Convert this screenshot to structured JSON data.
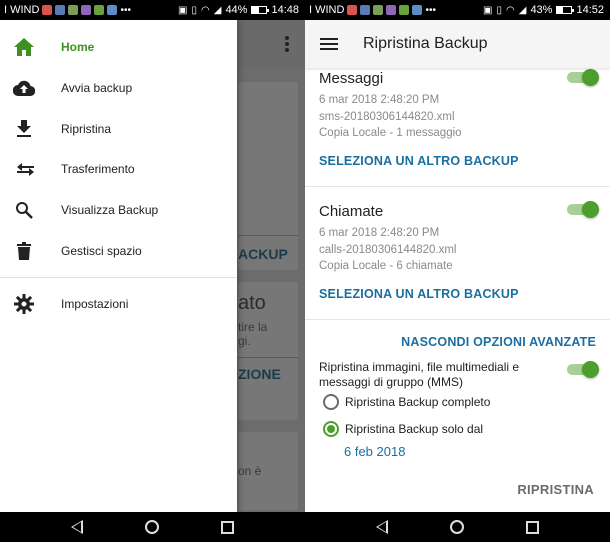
{
  "left": {
    "statusbar": {
      "carrier": "I WIND",
      "battery": "44%",
      "time": "14:48"
    },
    "background": {
      "partial_button_1": "ACKUP",
      "partial_title": "ato",
      "partial_text_1": "tire la",
      "partial_text_2": "gi.",
      "partial_button_2": "ZIONE",
      "partial_text_3": "on è"
    },
    "drawer": {
      "items": [
        {
          "label": "Home",
          "icon": "home-icon",
          "active": true
        },
        {
          "label": "Avvia backup",
          "icon": "cloud-upload-icon"
        },
        {
          "label": "Ripristina",
          "icon": "download-icon"
        },
        {
          "label": "Trasferimento",
          "icon": "transfer-icon"
        },
        {
          "label": "Visualizza Backup",
          "icon": "search-icon"
        },
        {
          "label": "Gestisci spazio",
          "icon": "trash-icon"
        }
      ],
      "settings": {
        "label": "Impostazioni",
        "icon": "gear-icon"
      }
    }
  },
  "right": {
    "statusbar": {
      "carrier": "I WIND",
      "battery": "43%",
      "time": "14:52"
    },
    "appbar": {
      "title": "Ripristina Backup"
    },
    "messaggi": {
      "title": "Messaggi",
      "date": "6 mar 2018 2:48:20 PM",
      "file": "sms-20180306144820.xml",
      "info": "Copia Locale - 1 messaggio",
      "link": "SELEZIONA UN ALTRO BACKUP"
    },
    "chiamate": {
      "title": "Chiamate",
      "date": "6 mar 2018 2:48:20 PM",
      "file": "calls-20180306144820.xml",
      "info": "Copia Locale - 6 chiamate",
      "link": "SELEZIONA UN ALTRO BACKUP"
    },
    "advanced": {
      "link": "NASCONDI OPZIONI AVANZATE",
      "mms_line1": "Ripristina immagini, file multimediali e",
      "mms_line2": "messaggi di gruppo (MMS)",
      "radio_full": "Ripristina Backup completo",
      "radio_since": "Ripristina Backup solo dal",
      "since_date": "6 feb 2018"
    },
    "footer": {
      "restore_button": "RIPRISTINA"
    }
  },
  "colors": {
    "accent_green": "#4e9e2e",
    "link_blue": "#1a6fa0"
  }
}
